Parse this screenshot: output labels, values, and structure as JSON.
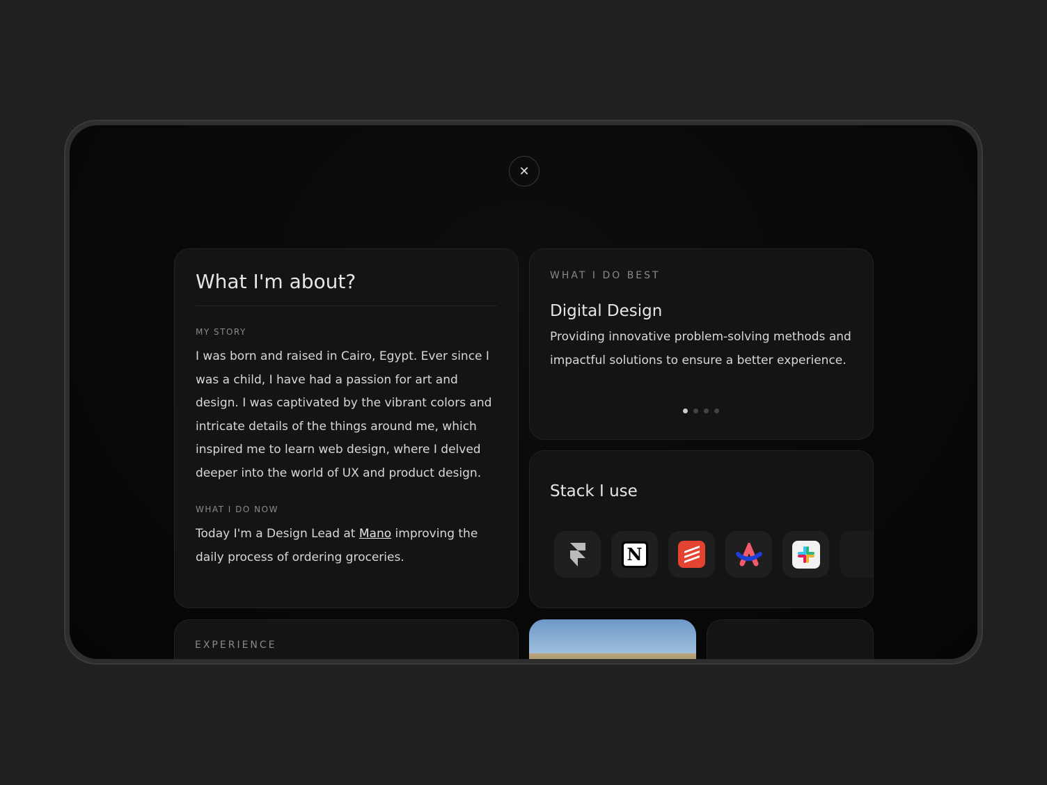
{
  "close_icon": "close-icon",
  "about": {
    "title": "What I'm about?",
    "story_label": "MY STORY",
    "story": "I was born and raised in Cairo, Egypt. Ever since I was a child, I have had a passion for art and design. I was captivated by the vibrant colors and intricate details of the things around me, which inspired me to learn web design, where I delved deeper into the world of UX and product design.",
    "now_label": "WHAT I DO NOW",
    "now_before": "Today I'm a Design Lead at ",
    "now_link": "Mano",
    "now_after": " improving the daily process of ordering groceries."
  },
  "best": {
    "label": "WHAT I DO BEST",
    "title": "Digital Design",
    "text": "Providing innovative problem-solving methods and impactful solutions to ensure a better experience.",
    "slides": 4,
    "active_slide": 1
  },
  "stack": {
    "title": "Stack I use",
    "tools": [
      "framer-icon",
      "notion-icon",
      "todoist-icon",
      "arc-icon",
      "slack-icon"
    ]
  },
  "experience": {
    "label": "EXPERIENCE"
  },
  "colors": {
    "todoist": "#e44332",
    "background": "#202020"
  }
}
